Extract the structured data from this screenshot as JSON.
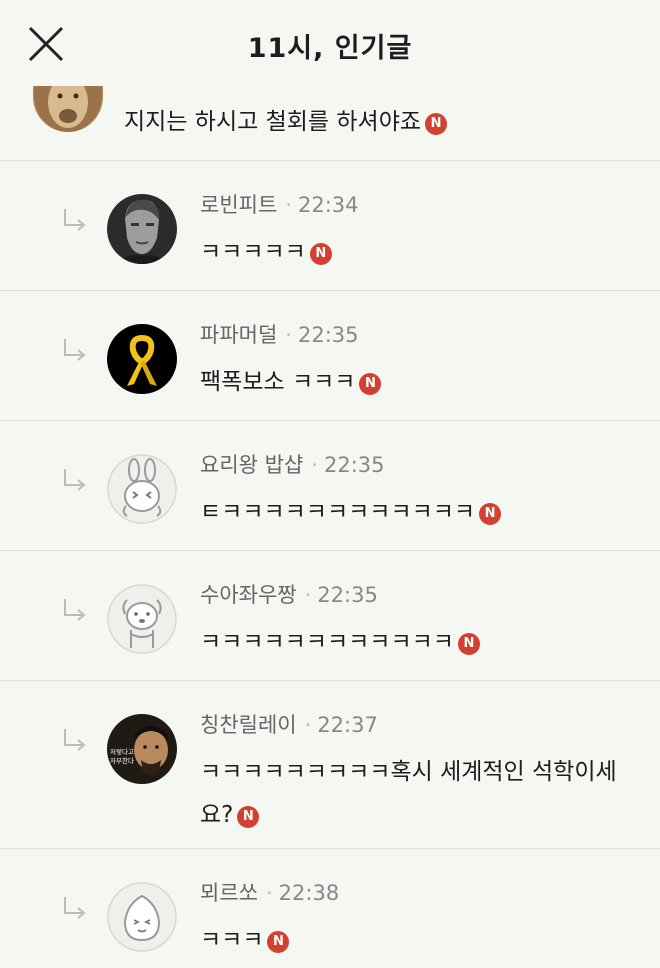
{
  "header": {
    "title": "11시, 인기글",
    "close_icon": "close-icon"
  },
  "parent_comment": {
    "text": "지지는 하시고 철회를 하셔야죠",
    "badge": "N",
    "avatar": "lion-avatar"
  },
  "replies": [
    {
      "author": "로빈피트",
      "time": "22:34",
      "text": "ㅋㅋㅋㅋㅋ",
      "badge": "N",
      "avatar": "bw-portrait-avatar"
    },
    {
      "author": "파파머덜",
      "time": "22:35",
      "text": "팩폭보소 ㅋㅋㅋ",
      "badge": "N",
      "avatar": "yellow-ribbon-avatar"
    },
    {
      "author": "요리왕 밥샵",
      "time": "22:35",
      "text": "ㅌㅋㅋㅋㅋㅋㅋㅋㅋㅋㅋㅋㅋ",
      "badge": "N",
      "avatar": "rabbit-default-avatar"
    },
    {
      "author": "수아좌우짱",
      "time": "22:35",
      "text": "ㅋㅋㅋㅋㅋㅋㅋㅋㅋㅋㅋㅋ",
      "badge": "N",
      "avatar": "dog-default-avatar"
    },
    {
      "author": "칭찬릴레이",
      "time": "22:37",
      "text": "ㅋㅋㅋㅋㅋㅋㅋㅋㅋ혹시 세계적인 석학이세요?",
      "badge": "N",
      "avatar": "drama-still-avatar",
      "avatar_caption": "저렇다고\n자부한다"
    },
    {
      "author": "뫼르쏘",
      "time": "22:38",
      "text": "ㅋㅋㅋ",
      "badge": "N",
      "avatar": "peach-default-avatar"
    }
  ],
  "colors": {
    "background": "#f4f7f2",
    "badge": "#d4402f",
    "divider": "#dde2da",
    "ribbon": "#f2c21b"
  }
}
